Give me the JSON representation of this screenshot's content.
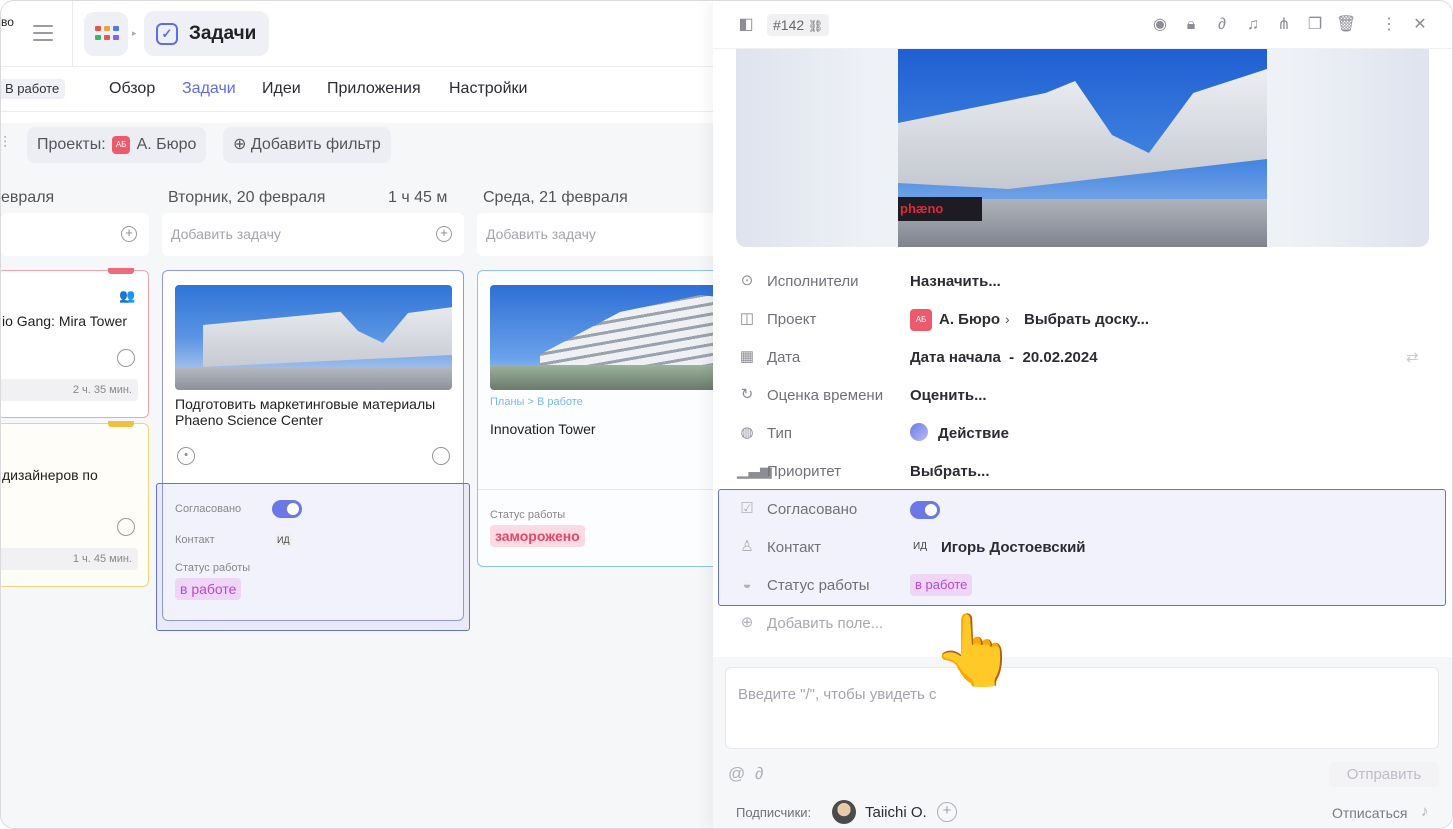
{
  "workspace_label": "во",
  "app_title": "Задачи",
  "status_chip": "В работе",
  "nav": [
    "Обзор",
    "Задачи",
    "Идеи",
    "Приложения",
    "Настройки"
  ],
  "filters": {
    "projects_label": "Проекты:",
    "project_badge": "АБ",
    "project_name": "А. Бюро",
    "add_filter": "Добавить фильтр"
  },
  "columns": [
    {
      "date": "евраля",
      "duration": "",
      "add_task": ""
    },
    {
      "date": "Вторник, 20 февраля",
      "duration": "1 ч 45 м",
      "add_task": "Добавить задачу"
    },
    {
      "date": "Среда, 21 февраля",
      "duration": "",
      "add_task": "Добавить задачу"
    }
  ],
  "cards": {
    "mira": {
      "title": "io Gang: Mira Tower",
      "time": "2 ч. 35 мин."
    },
    "designers": {
      "title": "дизайнеров по",
      "time": "1 ч. 45 мин."
    },
    "phaeno": {
      "title": "Подготовить маркетинговые материалы Phaeno Science Center",
      "approved_label": "Согласовано",
      "contact_label": "Контакт",
      "contact_initials": "ИД",
      "status_label": "Статус работы",
      "status_value": "в работе"
    },
    "innovation": {
      "path": "Планы > В работе",
      "title": "Innovation Tower",
      "status_label": "Статус работы",
      "status_value": "заморожено"
    }
  },
  "panel": {
    "task_id": "#142",
    "photo_brand": "phæno",
    "fields": [
      {
        "label": "Исполнители",
        "value": "Назначить...",
        "icon": "assignee-icon"
      },
      {
        "label": "Проект",
        "value": "А. Бюро",
        "extra": "Выбрать доску...",
        "icon": "project-icon"
      },
      {
        "label": "Дата",
        "value": "Дата начала  -  20.02.2024",
        "icon": "calendar-icon"
      },
      {
        "label": "Оценка времени",
        "value": "Оценить...",
        "icon": "estimate-icon"
      },
      {
        "label": "Тип",
        "value": "Действие",
        "icon": "type-icon"
      },
      {
        "label": "Приоритет",
        "value": "Выбрать...",
        "icon": "priority-icon"
      }
    ],
    "custom_fields": {
      "approved_label": "Согласовано",
      "contact_label": "Контакт",
      "contact_initials": "ИД",
      "contact_name": "Игорь Достоевский",
      "status_label": "Статус работы",
      "status_value": "в работе"
    },
    "add_field": "Добавить поле...",
    "composer_placeholder": "Введите \"/\", чтобы увидеть с",
    "send_label": "Отправить",
    "subscribers_label": "Подписчики:",
    "subscriber_name": "Taiichi O.",
    "unsubscribe_label": "Отписаться"
  },
  "colors": {
    "accent": "#5b6ee8",
    "highlight": "#6371d8",
    "status_purple": "#b44ad4",
    "status_red": "#e2456d"
  }
}
